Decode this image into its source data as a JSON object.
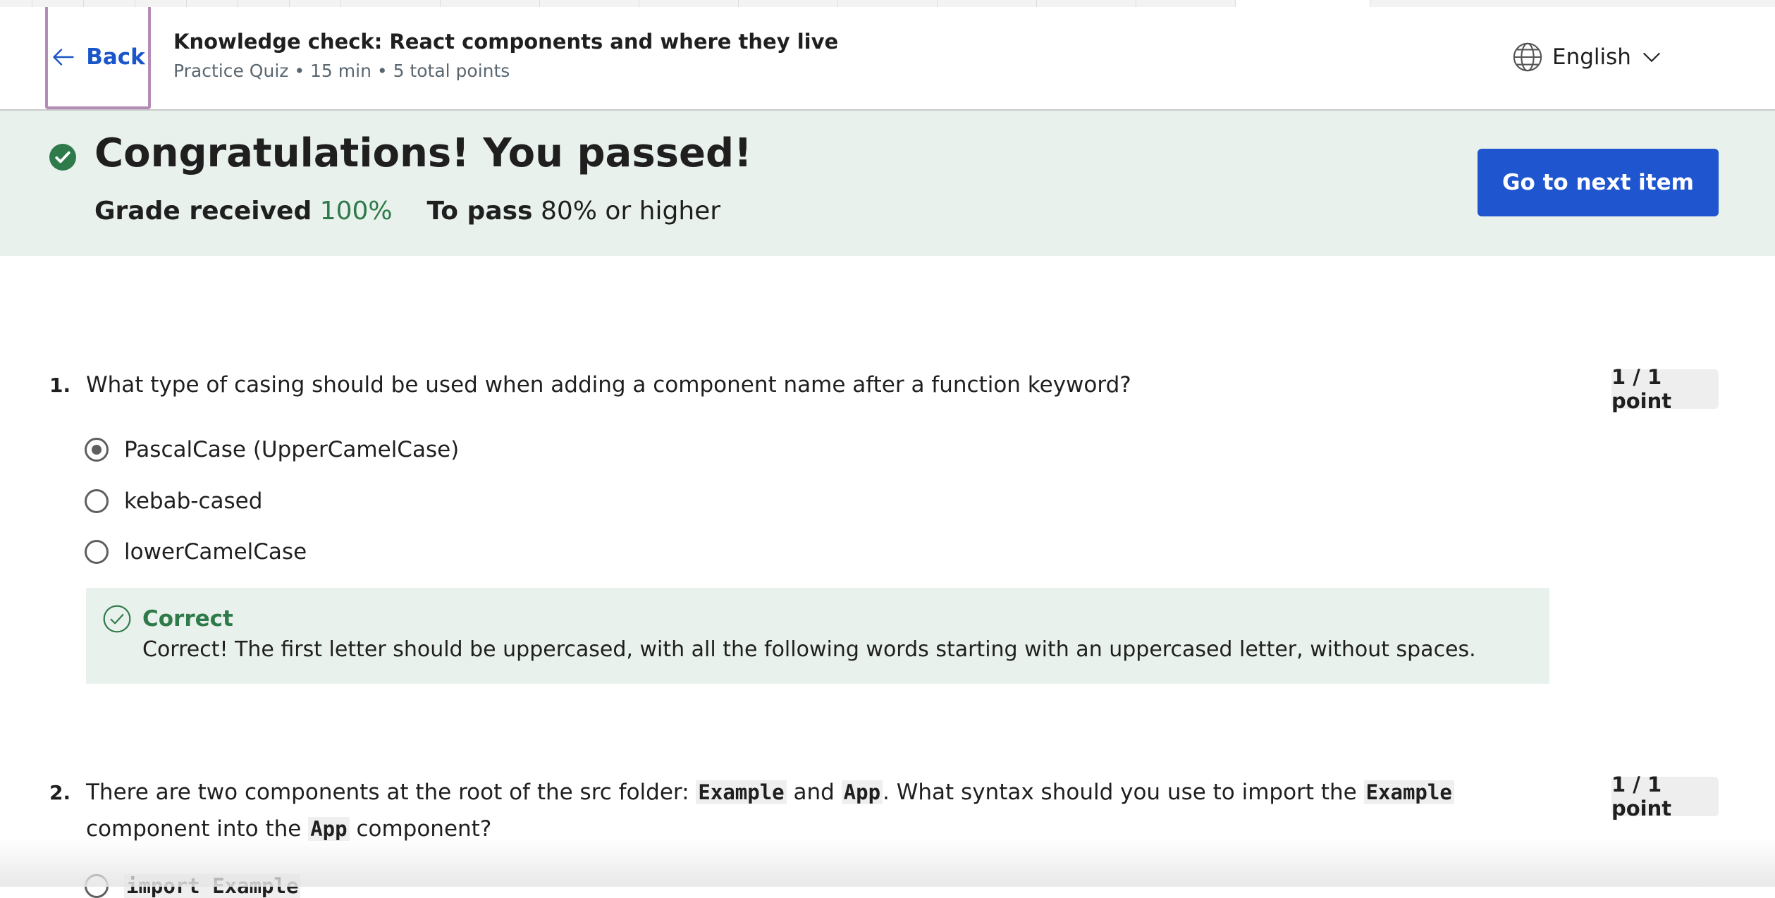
{
  "header": {
    "back_label": "Back",
    "title": "Knowledge check: React components and where they live",
    "meta": "Practice Quiz • 15 min • 5 total points",
    "language": "English"
  },
  "banner": {
    "heading": "Congratulations! You passed!",
    "grade_label": "Grade received",
    "grade_value": "100%",
    "pass_label": "To pass",
    "pass_value": "80% or higher",
    "next_button": "Go to next item"
  },
  "questions": [
    {
      "number": "1.",
      "text": "What type of casing should be used when adding a component name after a function keyword?",
      "points": "1 / 1 point",
      "options": [
        {
          "label": "PascalCase (UpperCamelCase)",
          "selected": true
        },
        {
          "label": "kebab-cased",
          "selected": false
        },
        {
          "label": "lowerCamelCase",
          "selected": false
        }
      ],
      "feedback": {
        "title": "Correct",
        "text": "Correct! The first letter should be uppercased, with all the following words starting with an uppercased letter, without spaces."
      }
    },
    {
      "number": "2.",
      "text_parts": [
        "There are two components at the root of the src folder: ",
        "Example",
        " and ",
        "App",
        ". What syntax should you use to import the ",
        "Example",
        " component into the ",
        "App",
        " component?"
      ],
      "points": "1 / 1 point",
      "partial_option": "import Example"
    }
  ],
  "colors": {
    "accent_blue": "#1f55cf",
    "success_green": "#2f7a4a",
    "banner_bg": "#e9f1ec"
  }
}
